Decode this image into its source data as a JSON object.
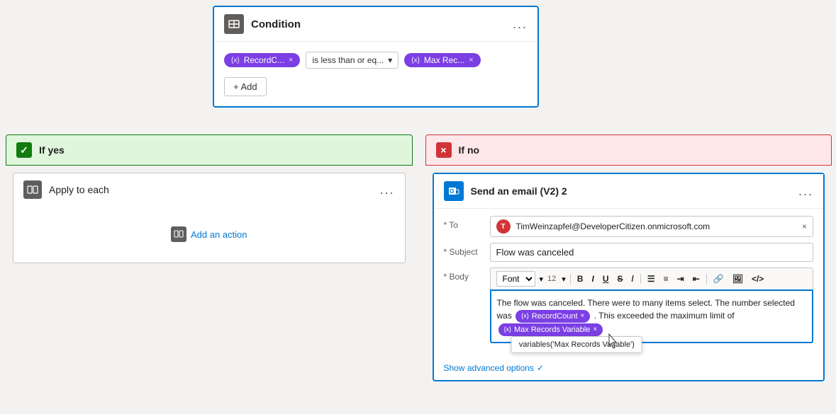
{
  "condition": {
    "title": "Condition",
    "chip1": {
      "label": "RecordC...",
      "icon": "{x}"
    },
    "chip2": {
      "label": "Max Rec...",
      "icon": "{x}"
    },
    "operator": "is less than or eq...",
    "add_label": "+ Add",
    "menu": "..."
  },
  "branches": {
    "yes_label": "If yes",
    "no_label": "If no"
  },
  "apply_each": {
    "title": "Apply to each",
    "add_action": "Add an action",
    "menu": "..."
  },
  "email_card": {
    "title": "Send an email (V2) 2",
    "menu": "...",
    "to_label": "* To",
    "to_value": "TimWeinzapfel@DeveloperCitizen.onmicrosoft.com",
    "to_avatar": "T",
    "subject_label": "* Subject",
    "subject_value": "Flow was canceled",
    "body_label": "* Body",
    "font_label": "Font",
    "size_label": "12",
    "body_text1": "The flow was canceled. There were to many items select. The number selected was",
    "body_token1": "RecordCount",
    "body_text2": ". This exceeded the maximum limit of",
    "body_token2": "Max Records Variable",
    "tooltip_text": "variables('Max Records Variable')",
    "show_advanced": "Show advanced options"
  }
}
